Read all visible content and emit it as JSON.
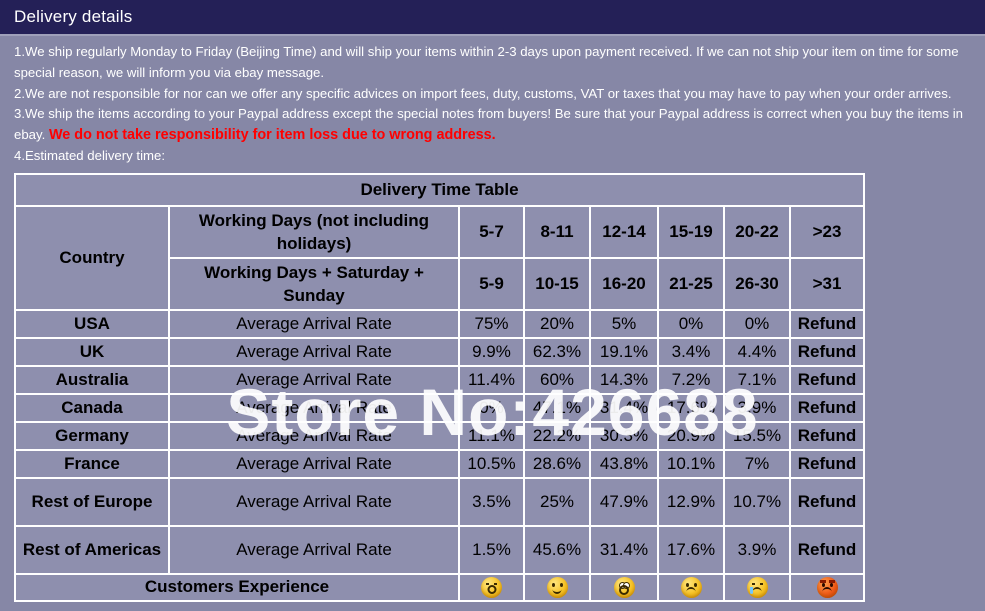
{
  "header": {
    "title": "Delivery details",
    "bar_color": "#242057",
    "text_color": "#ffffff"
  },
  "page": {
    "background_color": "#8687a6",
    "cell_color": "#8e8fae",
    "border_color": "#ffffff"
  },
  "policy": {
    "line1": "1.We ship regularly Monday to Friday (Beijing Time) and will ship your items within 2-3 days upon payment received. If we can not ship your item on time for some special reason, we will inform you via ebay message.",
    "line2": "2.We are not responsible for nor can we offer any specific advices on import fees, duty, customs, VAT or taxes that you may have to pay when your order arrives.",
    "line3_part1": "3.We ship the items according to your Paypal address except the special notes from buyers! Be sure that your Paypal address is correct when you buy the items in ebay. ",
    "line3_warning": "We do not take responsibility for item loss due to wrong address.",
    "warning_color": "#ff0000",
    "line4": "4.Estimated delivery time:"
  },
  "table": {
    "caption": "Delivery Time Table",
    "country_header": "Country",
    "working_days_label": "Working Days (not including holidays)",
    "working_days_weekend_label": "Working Days + Saturday + Sunday",
    "working_days_ranges": [
      "5-7",
      "8-11",
      "12-14",
      "15-19",
      "20-22",
      ">23"
    ],
    "working_days_weekend_ranges": [
      "5-9",
      "10-15",
      "16-20",
      "21-25",
      "26-30",
      ">31"
    ],
    "rate_label": "Average Arrival Rate",
    "rows": [
      {
        "country": "USA",
        "label": "Average Arrival Rate",
        "values": [
          "75%",
          "20%",
          "5%",
          "0%",
          "0%",
          "Refund"
        ]
      },
      {
        "country": "UK",
        "label": "Average Arrival Rate",
        "values": [
          "9.9%",
          "62.3%",
          "19.1%",
          "3.4%",
          "4.4%",
          "Refund"
        ]
      },
      {
        "country": "Australia",
        "label": "Average Arrival Rate",
        "values": [
          "11.4%",
          "60%",
          "14.3%",
          "7.2%",
          "7.1%",
          "Refund"
        ]
      },
      {
        "country": "Canada",
        "label": "Average Arrival Rate",
        "values": [
          "0%",
          "47.1%",
          "31.4%",
          "17.6%",
          "3.9%",
          "Refund"
        ]
      },
      {
        "country": "Germany",
        "label": "Average Arrival Rate",
        "values": [
          "11.1%",
          "22.2%",
          "30.3%",
          "20.9%",
          "15.5%",
          "Refund"
        ]
      },
      {
        "country": "France",
        "label": "Average Arrival Rate",
        "values": [
          "10.5%",
          "28.6%",
          "43.8%",
          "10.1%",
          "7%",
          "Refund"
        ]
      },
      {
        "country": "Rest of Europe",
        "label": "Average Arrival Rate",
        "values": [
          "3.5%",
          "25%",
          "47.9%",
          "12.9%",
          "10.7%",
          "Refund"
        ]
      },
      {
        "country": "Rest of Americas",
        "label": "Average Arrival Rate",
        "values": [
          "1.5%",
          "45.6%",
          "31.4%",
          "17.6%",
          "3.9%",
          "Refund"
        ]
      }
    ],
    "customers_experience_label": "Customers Experience",
    "experience_icons": [
      "kissing-face-icon",
      "smiling-face-icon",
      "shocked-face-icon",
      "frowning-face-icon",
      "crying-face-icon",
      "angry-face-icon"
    ]
  },
  "watermark": {
    "text": "Store No:426688"
  }
}
